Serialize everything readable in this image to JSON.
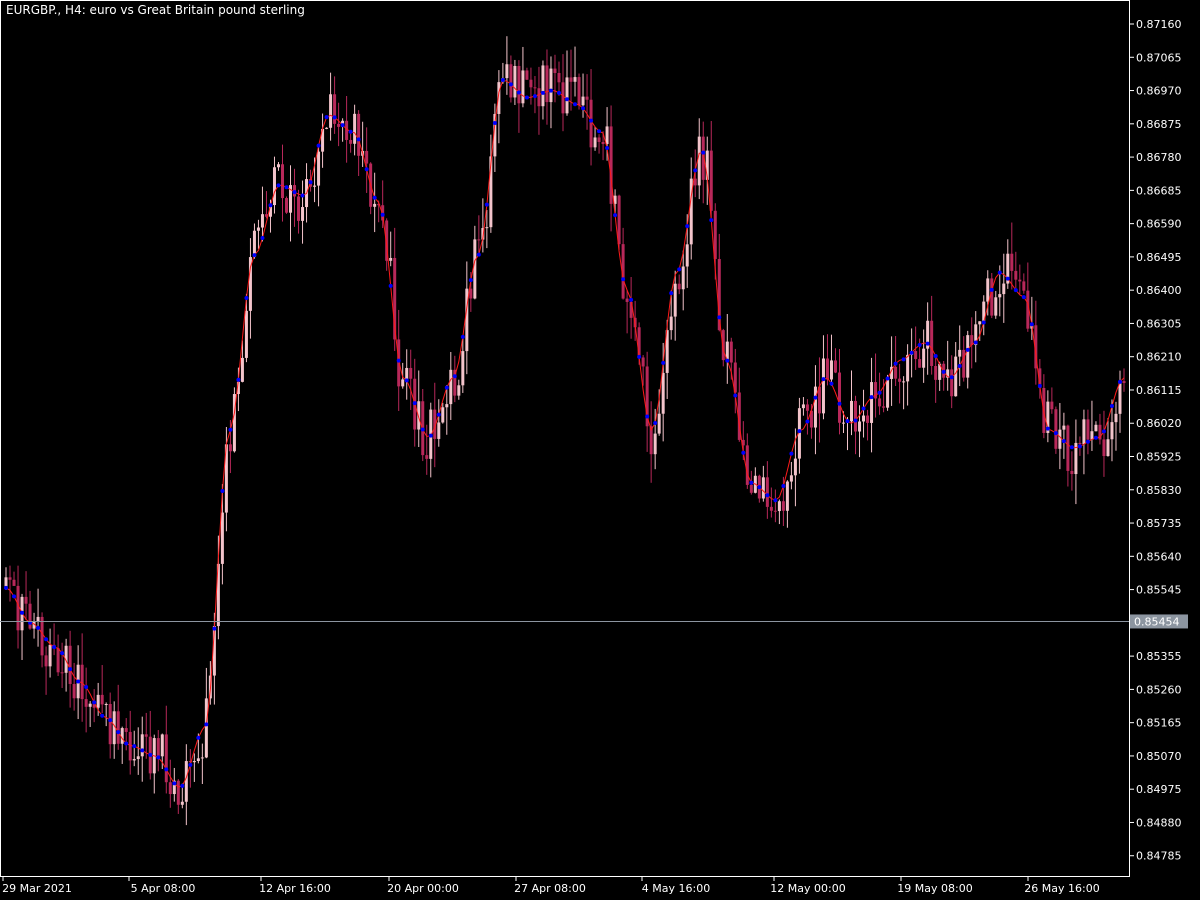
{
  "header": {
    "title": "EURGBP., H4:  euro vs Great Britain pound sterling"
  },
  "colors": {
    "background": "#000000",
    "axis": "#ffffff",
    "bull_candle": "#f3c4cb",
    "bear_candle": "#b8285a",
    "ma_line": "#ff1a1a",
    "ma_dots": "#0000ff",
    "current_price_line": "#8c95a0",
    "current_price_label_bg": "#8c95a0"
  },
  "chart_data": {
    "type": "candlestick",
    "title": "EURGBP., H4:  euro vs Great Britain pound sterling",
    "ylim": [
      0.8473,
      0.8722
    ],
    "y_ticks": [
      "0.87160",
      "0.87065",
      "0.86970",
      "0.86875",
      "0.86780",
      "0.86685",
      "0.86590",
      "0.86495",
      "0.86400",
      "0.86305",
      "0.86210",
      "0.86115",
      "0.86020",
      "0.85925",
      "0.85830",
      "0.85735",
      "0.85640",
      "0.85545",
      "0.85355",
      "0.85260",
      "0.85165",
      "0.85070",
      "0.84975",
      "0.84880",
      "0.84785"
    ],
    "x_ticks": [
      "29 Mar 2021",
      "5 Apr 08:00",
      "12 Apr 16:00",
      "20 Apr 00:00",
      "27 Apr 08:00",
      "4 May 16:00",
      "12 May 00:00",
      "19 May 08:00",
      "26 May 16:00"
    ],
    "current_price": "0.85454",
    "candle_count": 280,
    "series": [
      {
        "name": "",
        "kind": "moving-average",
        "anchor_values": [
          0.8555,
          0.8545,
          0.8538,
          0.8528,
          0.8518,
          0.851,
          0.8507,
          0.8498,
          0.8515,
          0.86,
          0.865,
          0.867,
          0.8667,
          0.869,
          0.8685,
          0.8665,
          0.8615,
          0.8598,
          0.8615,
          0.865,
          0.87,
          0.8695,
          0.8697,
          0.8693,
          0.8685,
          0.864,
          0.86,
          0.8645,
          0.868,
          0.862,
          0.8585,
          0.858,
          0.86,
          0.8615,
          0.8602,
          0.861,
          0.862,
          0.8625,
          0.8615,
          0.8625,
          0.8645,
          0.8638,
          0.86,
          0.8595,
          0.8598,
          0.8615
        ]
      }
    ]
  }
}
